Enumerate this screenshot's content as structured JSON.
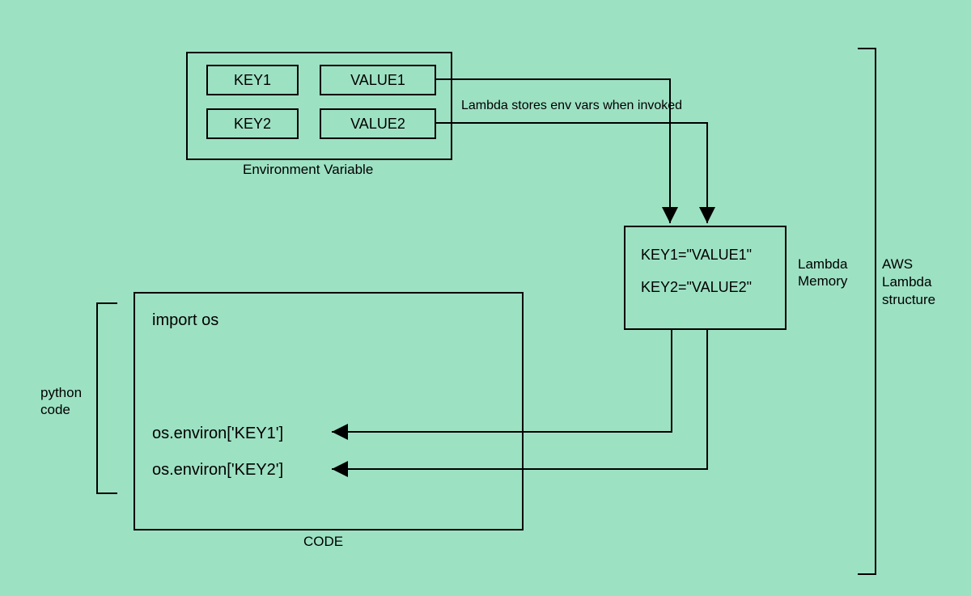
{
  "env_box": {
    "label": "Environment Variable",
    "rows": [
      {
        "key": "KEY1",
        "value": "VALUE1"
      },
      {
        "key": "KEY2",
        "value": "VALUE2"
      }
    ]
  },
  "arrow_note": "Lambda stores env vars when invoked",
  "memory_box": {
    "lines": [
      "KEY1=\"VALUE1\"",
      "KEY2=\"VALUE2\""
    ],
    "label": "Lambda Memory"
  },
  "code_box": {
    "label": "CODE",
    "import_line": "import os",
    "env_lines": [
      "os.environ['KEY1']",
      "os.environ['KEY2']"
    ],
    "side_label": "python code"
  },
  "structure_label": "AWS Lambda structure"
}
